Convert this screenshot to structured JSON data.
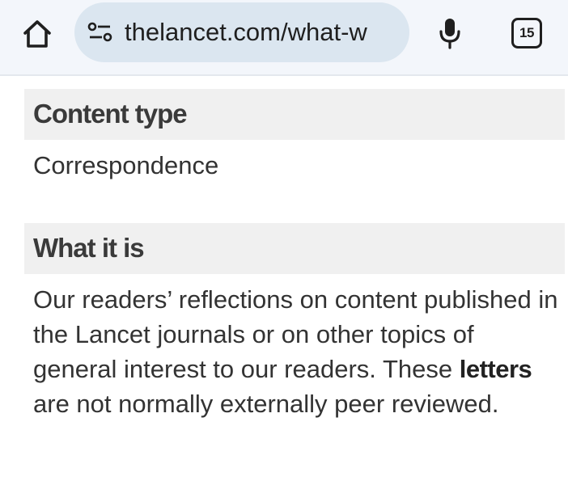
{
  "browser": {
    "url": "thelancet.com/what-w",
    "tab_count": "15",
    "icons": {
      "home": "home-icon",
      "site_settings": "tune-icon",
      "voice": "microphone-icon"
    }
  },
  "sections": [
    {
      "heading": "Content type",
      "body": "Correspondence"
    },
    {
      "heading": "What it is",
      "body_before": "Our readers’ reflections on content published in the Lancet journals or on other topics of general interest to our readers. These ",
      "body_bold": "letters",
      "body_after": " are not normally externally peer reviewed."
    }
  ],
  "colors": {
    "toolbar_bg": "#f3f6fb",
    "url_pill_bg": "#dbe6f0",
    "section_header_bg": "#f0f0f0"
  }
}
